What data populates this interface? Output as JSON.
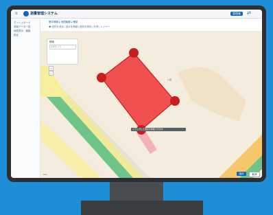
{
  "app": {
    "logo_text": "測量管理システム",
    "user_label": "管理者",
    "share_symbol": "⇄"
  },
  "sidebar": {
    "items": [
      {
        "label": "ダッシュボード"
      },
      {
        "label": "測量データ一覧"
      },
      {
        "label": "地図表示・編集"
      },
      {
        "label": "設定"
      }
    ]
  },
  "toolbar": {
    "tabs": "基本情報  ▸  地図編集  ▸  確認",
    "tools": "◆ 図形を追加  |  頂点を移動  |  図形を削除  |  計測  |  レイヤー"
  },
  "map": {
    "panel_title": "検索",
    "panel_placeholder": "住所を入力",
    "zoom_in": "+",
    "zoom_out": "−",
    "tooltip": "ドラッグして頂点を移動できます",
    "area_label": "公園",
    "scale": "10m",
    "confirm_label": "保存",
    "cancel_label": "取消",
    "polygon_color": "#f05050",
    "vertex_color": "#c81e1e"
  }
}
